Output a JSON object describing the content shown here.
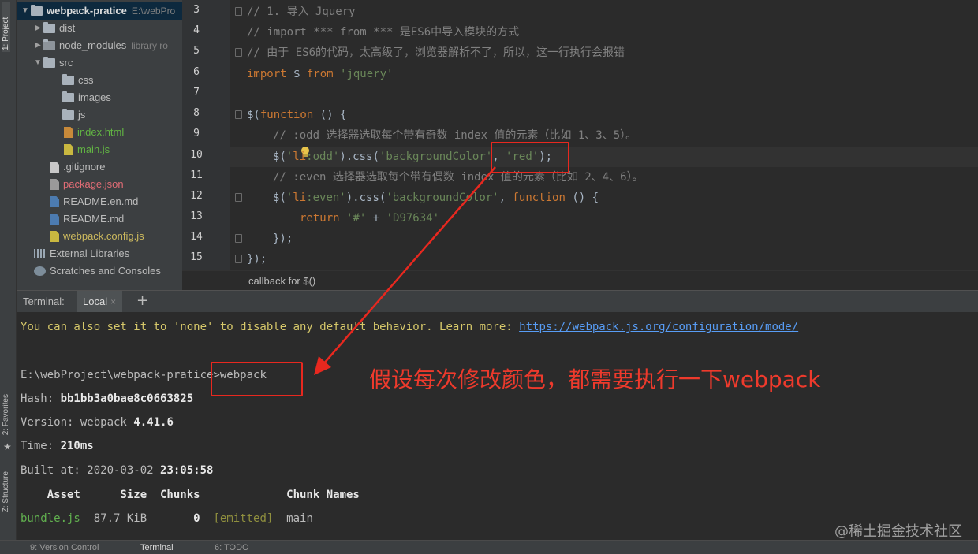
{
  "left_strip": {
    "project_tab": "1: Project",
    "favorites_tab": "2: Favorites",
    "structure_tab": "Z: Structure"
  },
  "project_tree": {
    "root_name": "webpack-pratice",
    "root_path": "E:\\webPro",
    "items": [
      {
        "label": "dist"
      },
      {
        "label": "node_modules",
        "extra": "library ro"
      },
      {
        "label": "src"
      },
      {
        "label": "css"
      },
      {
        "label": "images"
      },
      {
        "label": "js"
      },
      {
        "label": "index.html"
      },
      {
        "label": "main.js"
      },
      {
        "label": ".gitignore"
      },
      {
        "label": "package.json"
      },
      {
        "label": "README.en.md"
      },
      {
        "label": "README.md"
      },
      {
        "label": "webpack.config.js"
      },
      {
        "label": "External Libraries"
      },
      {
        "label": "Scratches and Consoles"
      }
    ]
  },
  "editor": {
    "line_numbers": [
      "3",
      "4",
      "5",
      "6",
      "7",
      "8",
      "9",
      "10",
      "11",
      "12",
      "13",
      "14",
      "15"
    ],
    "code": {
      "l3": "// 1. 导入 Jquery",
      "l4": "// import *** from *** 是ES6中导入模块的方式",
      "l5": "// 由于 ES6的代码，太高级了，浏览器解析不了，所以，这一行执行会报错",
      "l6_kw1": "import",
      "l6_mid": " $ ",
      "l6_kw2": "from",
      "l6_str": " 'jquery'",
      "l8_a": "$(",
      "l8_kw": "function",
      "l8_b": " () {",
      "l9": "// :odd 选择器选取每个带有奇数 index 值的元素（比如 1、3、5）。",
      "l10_a": "$(",
      "l10_q1": "'",
      "l10_sel": "li",
      "l10_s1": ":odd'",
      "l10_b": ").css(",
      "l10_s2": "'backgroundColor'",
      "l10_c": ", ",
      "l10_s3": "'red'",
      "l10_d": ");",
      "l11": "// :even 选择器选取每个带有偶数 index 值的元素（比如 2、4、6）。",
      "l12_a": "$(",
      "l12_q1": "'",
      "l12_sel": "li",
      "l12_s1": ":even'",
      "l12_b": ").css(",
      "l12_s2": "'backgroundColor'",
      "l12_c": ", ",
      "l12_kw": "function",
      "l12_d": " () {",
      "l13_kw": "return",
      "l13_s1": " '#'",
      "l13_op": " + ",
      "l13_s2": "'D97634'",
      "l14": "});",
      "l15": "});"
    },
    "breadcrumb": "callback for $()"
  },
  "terminal": {
    "label": "Terminal:",
    "tab": "Local",
    "tab_close": "×",
    "add": "+",
    "line1_text": "You can also set it to 'none' to disable any default behavior. Learn more: ",
    "line1_link": "https://webpack.js.org/configuration/mode/",
    "prompt_path": "E:\\webProject\\webpack-pratice>",
    "prompt_cmd": "webpack",
    "hash_label": "Hash: ",
    "hash_value": "bb1bb3a0bae8c0663825",
    "version_label": "Version: webpack ",
    "version_value": "4.41.6",
    "time_label": "Time: ",
    "time_value": "210ms",
    "built_label": "Built at: 2020-03-02 ",
    "built_value": "23:05:58",
    "table_header": "    Asset      Size  Chunks             Chunk Names",
    "row_file": "bundle.js",
    "row_size": "  87.7 KiB       ",
    "row_chunk": "0",
    "row_emitted": "  [emitted]",
    "row_name": "  main"
  },
  "bottom_bar": {
    "version_control": "9: Version Control",
    "terminal": "Terminal",
    "todo": "6: TODO"
  },
  "annotation": {
    "text": "假设每次修改颜色，都需要执行一下webpack",
    "color": "#ee3a2c"
  },
  "watermark": "@稀土掘金技术社区"
}
